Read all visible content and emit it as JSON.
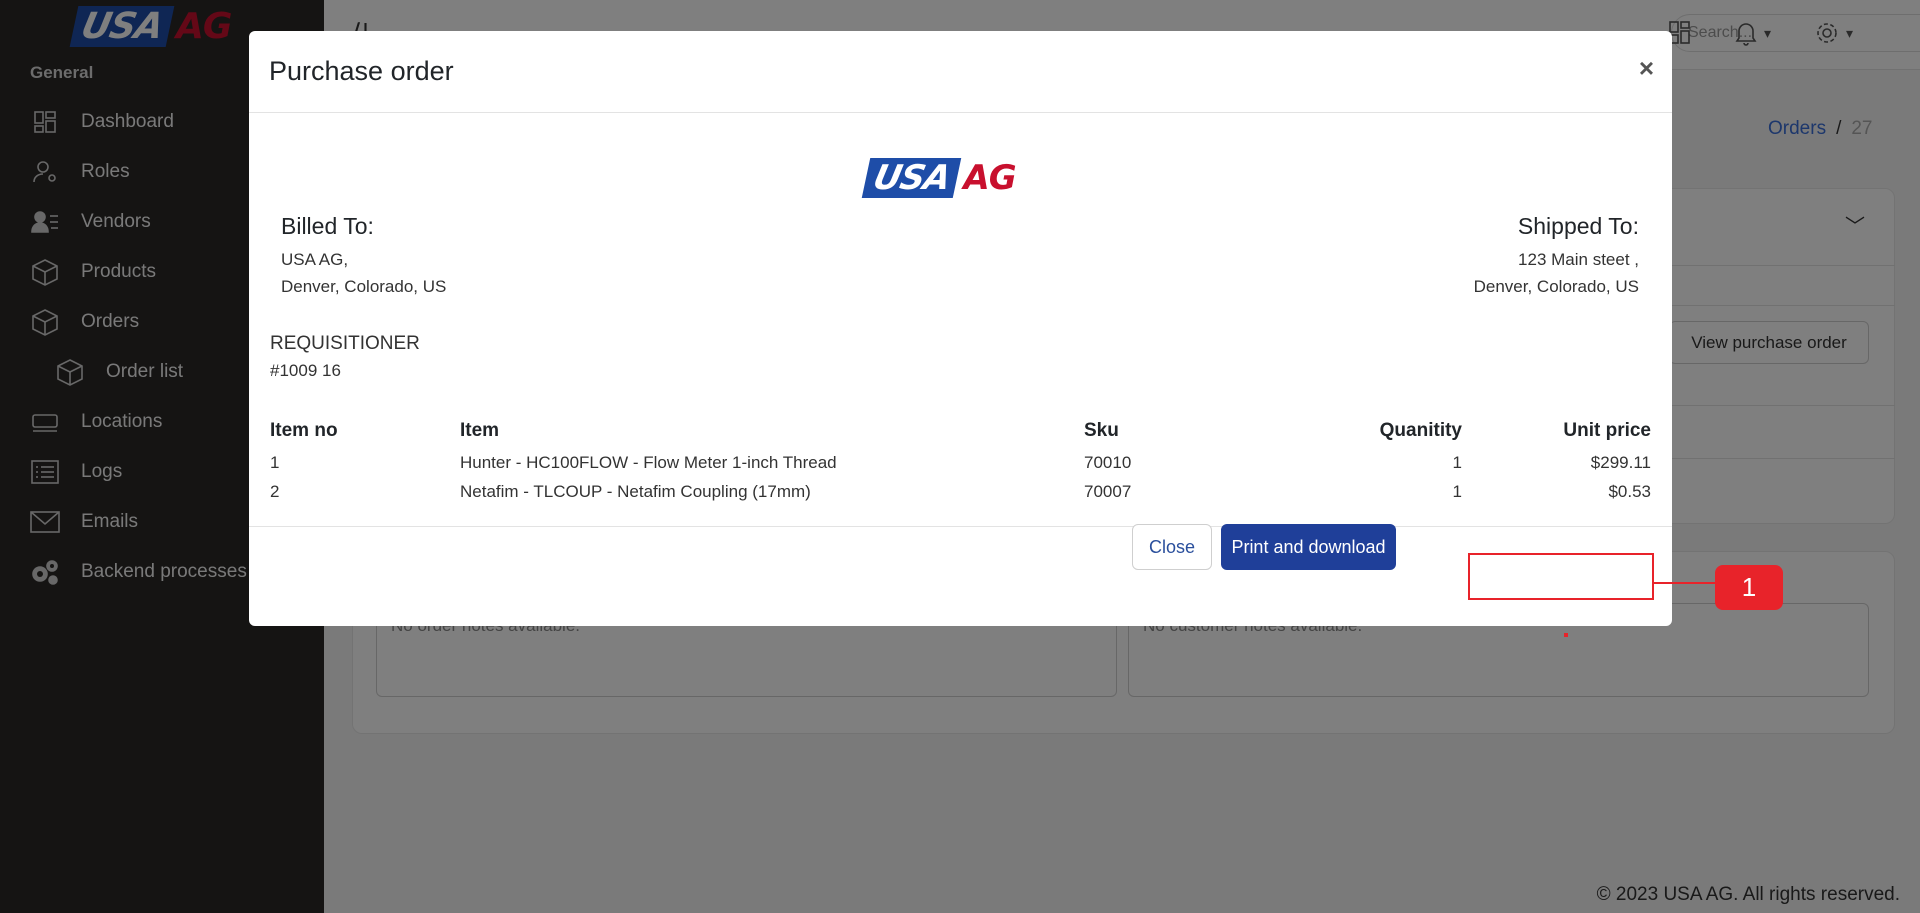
{
  "brand": {
    "usa": "USA",
    "ag": "AG",
    "blue": "#1e4da8",
    "red": "#c8102e"
  },
  "sidebar": {
    "section": "General",
    "items": [
      {
        "label": "Dashboard",
        "icon": "dashboard-icon"
      },
      {
        "label": "Roles",
        "icon": "user-gear-icon"
      },
      {
        "label": "Vendors",
        "icon": "users-list-icon"
      },
      {
        "label": "Products",
        "icon": "box-icon"
      },
      {
        "label": "Orders",
        "icon": "box-icon"
      },
      {
        "label": "Order list",
        "icon": "box-icon"
      },
      {
        "label": "Locations",
        "icon": "location-icon"
      },
      {
        "label": "Logs",
        "icon": "list-icon"
      },
      {
        "label": "Emails",
        "icon": "envelope-icon"
      },
      {
        "label": "Backend processes",
        "icon": "gears-icon"
      }
    ]
  },
  "topbar": {
    "search_placeholder": "Search..."
  },
  "breadcrumb": {
    "link": "Orders",
    "separator": "/",
    "current": "27"
  },
  "main": {
    "view_purchase_order": "View purchase order",
    "order_notes": "No order notes available.",
    "customer_notes": "No customer notes available."
  },
  "footer": "© 2023 USA AG. All rights reserved.",
  "modal": {
    "title": "Purchase order",
    "close_symbol": "×",
    "billed": {
      "title": "Billed To:",
      "line1": "USA AG,",
      "line2": "Denver, Colorado, US"
    },
    "shipped": {
      "title": "Shipped To:",
      "line1": "123 Main steet ,",
      "line2": "Denver, Colorado, US"
    },
    "requisitioner": {
      "title": "REQUISITIONER",
      "number": "#1009 16"
    },
    "table": {
      "headers": [
        "Item no",
        "Item",
        "Sku",
        "Quanitity",
        "Unit price"
      ],
      "rows": [
        [
          "1",
          "Hunter - HC100FLOW - Flow Meter 1-inch Thread",
          "70010",
          "1",
          "$299.11"
        ],
        [
          "2",
          "Netafim - TLCOUP - Netafim Coupling (17mm)",
          "70007",
          "1",
          "$0.53"
        ]
      ]
    },
    "close_button": "Close",
    "print_button": "Print and download"
  },
  "annotation": {
    "label": "1",
    "color": "#e8232a"
  }
}
